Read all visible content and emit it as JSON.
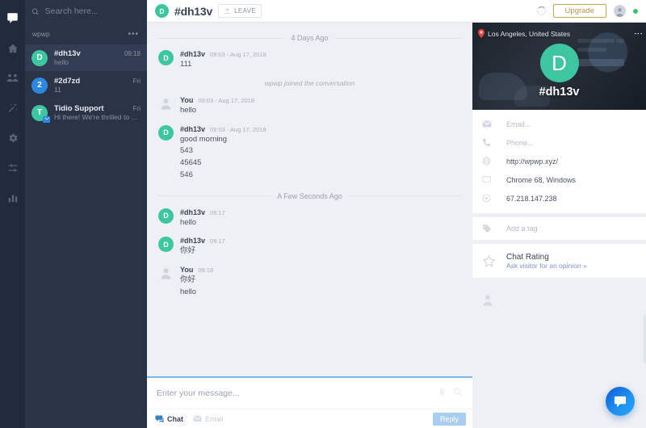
{
  "rail": {
    "items": [
      {
        "icon": "chat-bubble-icon",
        "name": "rail-item-conversations",
        "active": true
      },
      {
        "icon": "home-icon",
        "name": "rail-item-home",
        "active": false
      },
      {
        "icon": "visitors-icon",
        "name": "rail-item-visitors",
        "active": false
      },
      {
        "icon": "magic-wand-icon",
        "name": "rail-item-automation",
        "active": false
      },
      {
        "icon": "gear-icon",
        "name": "rail-item-settings",
        "active": false
      },
      {
        "icon": "sliders-icon",
        "name": "rail-item-preferences",
        "active": false
      },
      {
        "icon": "bar-chart-icon",
        "name": "rail-item-analytics",
        "active": false
      }
    ]
  },
  "sidebar": {
    "search": {
      "placeholder": "Search here...",
      "value": ""
    },
    "group": {
      "label": "wpwp",
      "menu": "•••"
    },
    "conversations": [
      {
        "avatar_letter": "D",
        "avatar_color": "#3ec6a0",
        "badge": false,
        "name": "#dh13v",
        "time": "09:18",
        "preview": "hello",
        "selected": true
      },
      {
        "avatar_letter": "2",
        "avatar_color": "#2f86e0",
        "badge": false,
        "name": "#2d7zd",
        "time": "Fri",
        "preview": "11",
        "selected": false
      },
      {
        "avatar_letter": "T",
        "avatar_color": "#3ec6a0",
        "badge": true,
        "name": "Tidio Support",
        "time": "Fri",
        "preview": "Hi there! We're thrilled to welco...",
        "selected": false
      }
    ]
  },
  "chat_header": {
    "avatar_letter": "D",
    "title": "#dh13v",
    "leave_label": "LEAVE"
  },
  "top_bar": {
    "upgrade_label": "Upgrade",
    "status": "online"
  },
  "messages": [
    {
      "kind": "separator",
      "text": "4 Days Ago"
    },
    {
      "kind": "message",
      "side": "visitor",
      "avatar_letter": "D",
      "from": "#dh13v",
      "time": "09:03 - Aug 17, 2018",
      "lines": [
        "111"
      ]
    },
    {
      "kind": "system",
      "text": "wpwp joined the conversation"
    },
    {
      "kind": "message",
      "side": "agent",
      "avatar_letter": "",
      "from": "You",
      "time": "09:03 - Aug 17, 2018",
      "lines": [
        "hello"
      ]
    },
    {
      "kind": "message",
      "side": "visitor",
      "avatar_letter": "D",
      "from": "#dh13v",
      "time": "09:03 - Aug 17, 2018",
      "lines": [
        "good morning",
        "543",
        "45645",
        "546"
      ]
    },
    {
      "kind": "separator",
      "text": "A Few Seconds Ago"
    },
    {
      "kind": "message",
      "side": "visitor",
      "avatar_letter": "D",
      "from": "#dh13v",
      "time": "09:17",
      "lines": [
        "hello"
      ]
    },
    {
      "kind": "message",
      "side": "visitor",
      "avatar_letter": "D",
      "from": "#dh13v",
      "time": "09:17",
      "lines": [
        "你好"
      ]
    },
    {
      "kind": "message",
      "side": "agent",
      "avatar_letter": "",
      "from": "You",
      "time": "09:18",
      "lines": [
        "你好",
        "hello"
      ]
    }
  ],
  "composer": {
    "placeholder": "Enter your message...",
    "value": "",
    "tabs": [
      {
        "label": "Chat",
        "icon": "chat-bubble-icon",
        "active": true
      },
      {
        "label": "Email",
        "icon": "envelope-icon",
        "active": false
      }
    ],
    "reply_label": "Reply"
  },
  "visitor": {
    "location": "Los Angeles, United States",
    "avatar_letter": "D",
    "name": "#dh13v",
    "info": [
      {
        "icon": "envelope-icon",
        "value": "Email...",
        "placeholder": true
      },
      {
        "icon": "phone-icon",
        "value": "Phone...",
        "placeholder": true
      },
      {
        "icon": "globe-icon",
        "value": "http://wpwp.xyz/",
        "placeholder": false
      },
      {
        "icon": "monitor-icon",
        "value": "Chrome 68, Windows",
        "placeholder": false
      },
      {
        "icon": "target-icon",
        "value": "67.218.147.238",
        "placeholder": false
      }
    ],
    "tag": {
      "icon": "tag-icon",
      "label": "Add a tag"
    },
    "rating": {
      "icon": "star-icon",
      "title": "Chat Rating",
      "link": "Ask visitor for an opinion »"
    }
  },
  "colors": {
    "accent_teal": "#3ec6a0",
    "accent_blue": "#2f86e0",
    "upgrade_gold": "#cba857",
    "online_green": "#3dc46b",
    "sidebar_dark": "#2b3447",
    "rail_dark": "#222b3c"
  }
}
